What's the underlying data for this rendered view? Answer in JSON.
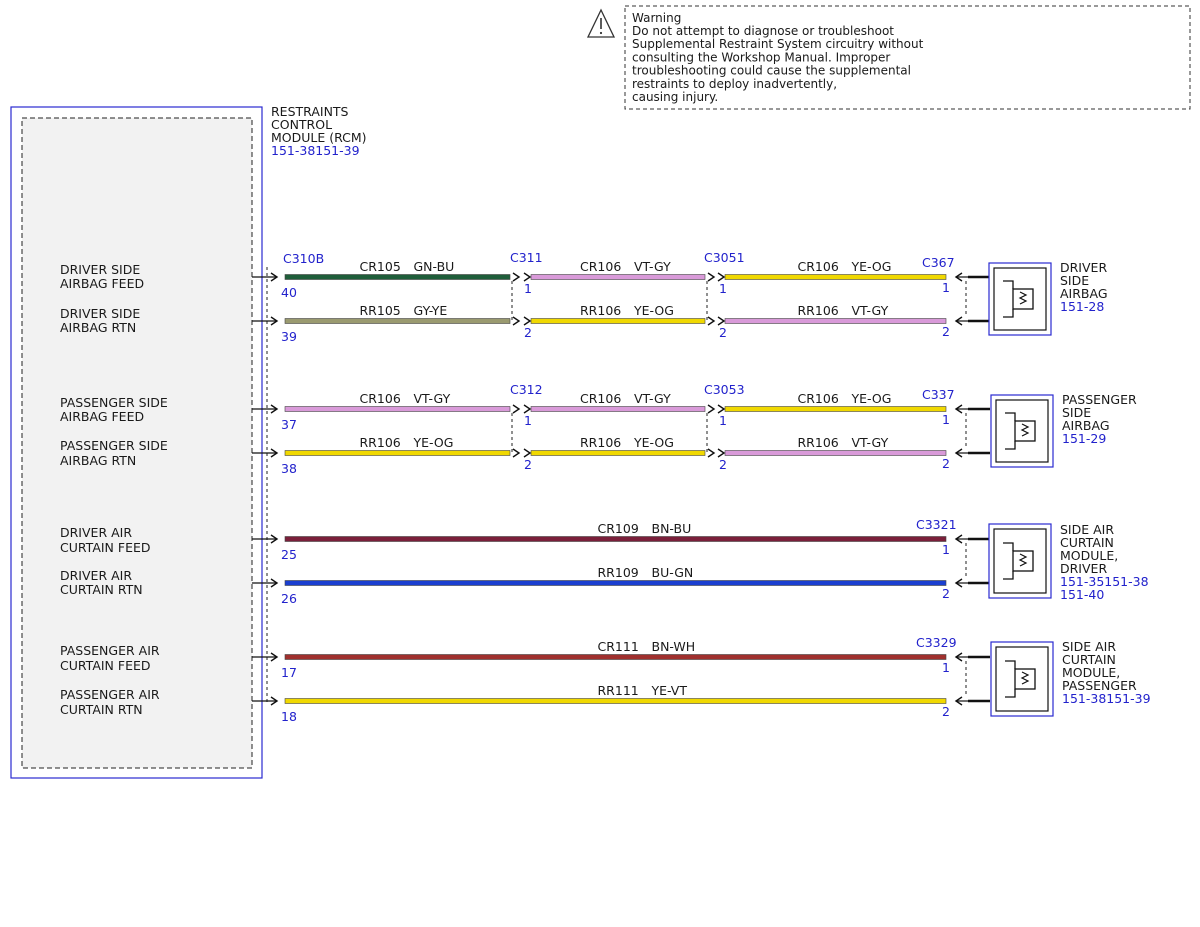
{
  "warning": {
    "title": "Warning",
    "lines": [
      "Do not attempt to diagnose or troubleshoot",
      "Supplemental Restraint System circuitry without",
      "consulting the Workshop Manual. Improper",
      "troubleshooting could cause the supplemental",
      "restraints to deploy inadvertently,",
      "causing injury."
    ]
  },
  "rcm": {
    "title_lines": [
      "RESTRAINTS",
      "CONTROL",
      "MODULE (RCM)"
    ],
    "ref": "151-38151-39"
  },
  "circuits": [
    {
      "feed_label": [
        "DRIVER SIDE",
        "AIRBAG FEED"
      ],
      "rtn_label": [
        "DRIVER SIDE",
        "AIRBAG RTN"
      ],
      "feed_pin": "40",
      "rtn_pin": "39",
      "segments": [
        {
          "connector": "C310B",
          "feed": {
            "circuit": "CR105",
            "color": "GN-BU",
            "hex": "#1f5e3a"
          },
          "rtn": {
            "circuit": "RR105",
            "color": "GY-YE",
            "hex": "#9a9a70"
          }
        },
        {
          "connector": "C311",
          "feed": {
            "circuit": "CR106",
            "color": "VT-GY",
            "hex": "#d99ad9"
          },
          "rtn": {
            "circuit": "RR106",
            "color": "YE-OG",
            "hex": "#f0d800"
          }
        },
        {
          "connector": "C3051",
          "feed": {
            "circuit": "CR106",
            "color": "YE-OG",
            "hex": "#f0d800"
          },
          "rtn": {
            "circuit": "RR106",
            "color": "VT-GY",
            "hex": "#d99ad9"
          }
        }
      ],
      "end_connector": "C367",
      "end_pins": [
        "1",
        "2"
      ],
      "mid_pins": [
        "1",
        "2"
      ],
      "device": [
        "DRIVER",
        "SIDE",
        "AIRBAG"
      ],
      "device_ref": [
        "151-28"
      ]
    },
    {
      "feed_label": [
        "PASSENGER SIDE",
        "AIRBAG FEED"
      ],
      "rtn_label": [
        "PASSENGER SIDE",
        "AIRBAG RTN"
      ],
      "feed_pin": "37",
      "rtn_pin": "38",
      "segments": [
        {
          "connector": "",
          "feed": {
            "circuit": "CR106",
            "color": "VT-GY",
            "hex": "#d99ad9"
          },
          "rtn": {
            "circuit": "RR106",
            "color": "YE-OG",
            "hex": "#f0d800"
          }
        },
        {
          "connector": "C312",
          "feed": {
            "circuit": "CR106",
            "color": "VT-GY",
            "hex": "#d99ad9"
          },
          "rtn": {
            "circuit": "RR106",
            "color": "YE-OG",
            "hex": "#f0d800"
          }
        },
        {
          "connector": "C3053",
          "feed": {
            "circuit": "CR106",
            "color": "YE-OG",
            "hex": "#f0d800"
          },
          "rtn": {
            "circuit": "RR106",
            "color": "VT-GY",
            "hex": "#d99ad9"
          }
        }
      ],
      "end_connector": "C337",
      "end_pins": [
        "1",
        "2"
      ],
      "mid_pins": [
        "1",
        "2"
      ],
      "device": [
        "PASSENGER",
        "SIDE",
        "AIRBAG"
      ],
      "device_ref": [
        "151-29"
      ]
    },
    {
      "feed_label": [
        "DRIVER AIR",
        "CURTAIN FEED"
      ],
      "rtn_label": [
        "DRIVER AIR",
        "CURTAIN RTN"
      ],
      "feed_pin": "25",
      "rtn_pin": "26",
      "segments": [
        {
          "connector": "",
          "feed": {
            "circuit": "CR109",
            "color": "BN-BU",
            "hex": "#7a1f3a"
          },
          "rtn": {
            "circuit": "RR109",
            "color": "BU-GN",
            "hex": "#1a3fd0"
          }
        }
      ],
      "end_connector": "C3321",
      "end_pins": [
        "1",
        "2"
      ],
      "device": [
        "SIDE AIR",
        "CURTAIN",
        "MODULE,",
        "DRIVER"
      ],
      "device_ref": [
        "151-35151-38",
        "151-40"
      ]
    },
    {
      "feed_label": [
        "PASSENGER AIR",
        "CURTAIN FEED"
      ],
      "rtn_label": [
        "PASSENGER AIR",
        "CURTAIN RTN"
      ],
      "feed_pin": "17",
      "rtn_pin": "18",
      "segments": [
        {
          "connector": "",
          "feed": {
            "circuit": "CR111",
            "color": "BN-WH",
            "hex": "#a0302e"
          },
          "rtn": {
            "circuit": "RR111",
            "color": "YE-VT",
            "hex": "#f0d800"
          }
        }
      ],
      "end_connector": "C3329",
      "end_pins": [
        "1",
        "2"
      ],
      "device": [
        "SIDE AIR",
        "CURTAIN",
        "MODULE,",
        "PASSENGER"
      ],
      "device_ref": [
        "151-38151-39"
      ]
    }
  ]
}
